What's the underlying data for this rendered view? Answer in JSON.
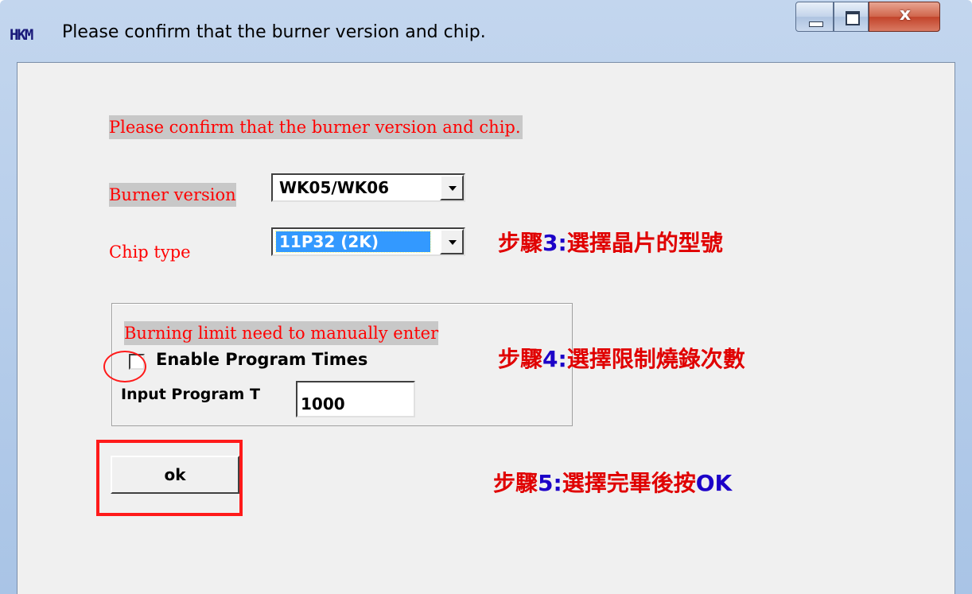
{
  "window": {
    "title": "Please confirm that the burner version and chip.",
    "icon_text": "HKM",
    "icon": "app-logo-icon",
    "controls": {
      "minimize": "minimize-icon",
      "maximize": "maximize-icon",
      "close_glyph": "x"
    }
  },
  "dialog": {
    "header": "Please confirm that the burner version and chip.",
    "burner_version_label": "Burner version",
    "burner_version_value": "WK05/WK06",
    "chip_type_label": "Chip type",
    "chip_type_value": "11P32  (2K)",
    "group": {
      "label": "Burning limit need to manually enter",
      "enable_program_times_label": "Enable Program Times",
      "enable_program_times_checked": false,
      "input_program_label": "Input Program T",
      "input_program_value": "1000"
    },
    "ok_label": "ok"
  },
  "annotations": {
    "step3": {
      "prefix": "步驟",
      "num": "3:",
      "text": "選擇晶片的型號"
    },
    "step4": {
      "prefix": "步驟",
      "num": "4:",
      "text": "選擇限制燒錄次數"
    },
    "step5": {
      "prefix": "步驟",
      "num": "5:",
      "text": "選擇完畢後按",
      "suffix": "OK"
    }
  },
  "colors": {
    "annotation_red": "#e00000",
    "annotation_blue": "#1c00c8",
    "label_red": "#ff0000",
    "selection_blue": "#3399ff"
  }
}
